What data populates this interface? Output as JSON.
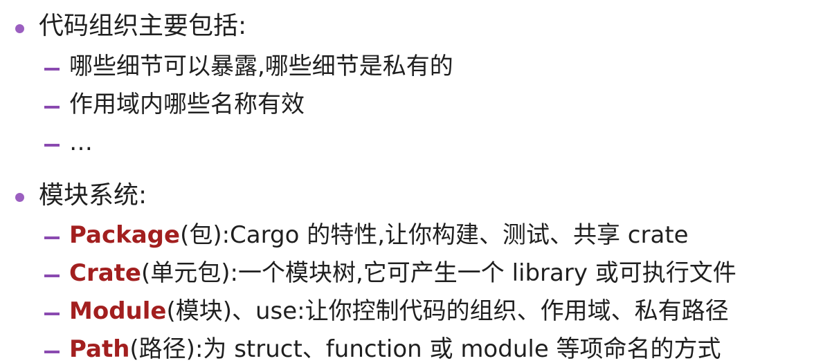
{
  "section1": {
    "heading": "代码组织主要包括:",
    "items": [
      "哪些细节可以暴露,哪些细节是私有的",
      "作用域内哪些名称有效",
      "…"
    ]
  },
  "section2": {
    "heading": "模块系统:",
    "items": [
      {
        "term": "Package",
        "text": "(包):Cargo 的特性,让你构建、测试、共享 crate"
      },
      {
        "term": "Crate",
        "text": "(单元包):一个模块树,它可产生一个 library 或可执行文件"
      },
      {
        "term": "Module",
        "text": "(模块)、use:让你控制代码的组织、作用域、私有路径"
      },
      {
        "term": "Path",
        "text": "(路径):为 struct、function 或 module 等项命名的方式"
      }
    ]
  },
  "colors": {
    "bullet": "#9b5fc0",
    "dash": "#8a4ab0",
    "term": "#a21f1f",
    "text": "#1f1f1f"
  }
}
